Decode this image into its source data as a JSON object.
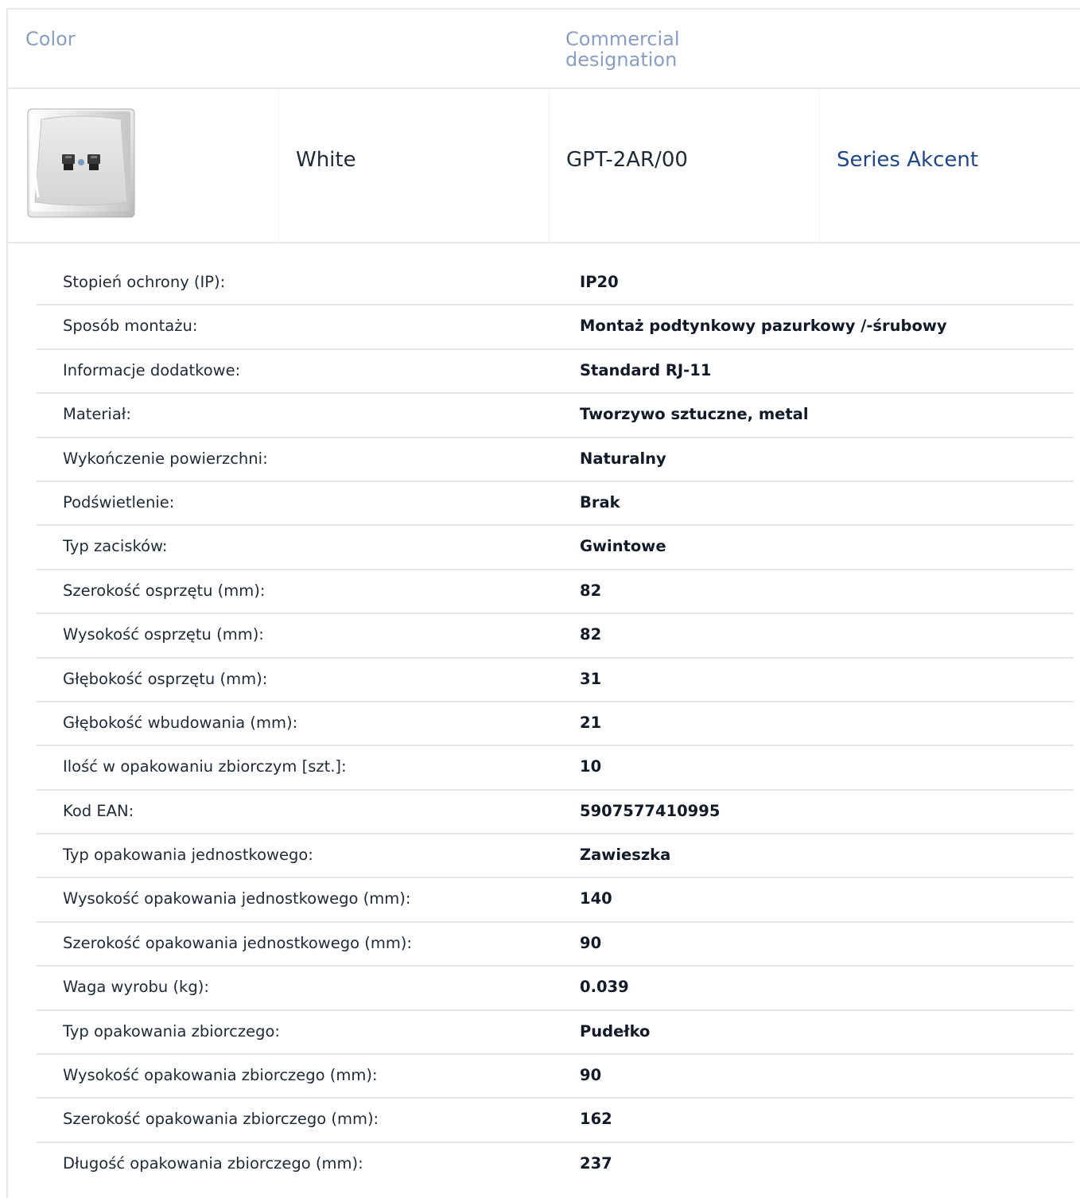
{
  "header": {
    "color_label": "Color",
    "designation_label": "Commercial designation"
  },
  "product": {
    "color": "White",
    "code": "GPT-2AR/00",
    "series": "Series Akcent",
    "thumbnail_icon": "double-telephone-socket-icon"
  },
  "specs": [
    {
      "label": "Stopień ochrony (IP):",
      "value": "IP20"
    },
    {
      "label": "Sposób montażu:",
      "value": "Montaż podtynkowy pazurkowy /-śrubowy"
    },
    {
      "label": "Informacje dodatkowe:",
      "value": "Standard RJ-11"
    },
    {
      "label": "Materiał:",
      "value": "Tworzywo sztuczne, metal"
    },
    {
      "label": "Wykończenie powierzchni:",
      "value": "Naturalny"
    },
    {
      "label": "Podświetlenie:",
      "value": "Brak"
    },
    {
      "label": "Typ zacisków:",
      "value": "Gwintowe"
    },
    {
      "label": "Szerokość osprzętu (mm):",
      "value": "82"
    },
    {
      "label": "Wysokość osprzętu (mm):",
      "value": "82"
    },
    {
      "label": "Głębokość osprzętu (mm):",
      "value": "31"
    },
    {
      "label": "Głębokość wbudowania (mm):",
      "value": "21"
    },
    {
      "label": "Ilość w opakowaniu zbiorczym [szt.]:",
      "value": "10"
    },
    {
      "label": "Kod EAN:",
      "value": "5907577410995"
    },
    {
      "label": "Typ opakowania jednostkowego:",
      "value": "Zawieszka"
    },
    {
      "label": "Wysokość opakowania jednostkowego (mm):",
      "value": "140"
    },
    {
      "label": "Szerokość opakowania jednostkowego (mm):",
      "value": "90"
    },
    {
      "label": "Waga wyrobu (kg):",
      "value": "0.039"
    },
    {
      "label": "Typ opakowania zbiorczego:",
      "value": "Pudełko"
    },
    {
      "label": "Wysokość opakowania zbiorczego (mm):",
      "value": "90"
    },
    {
      "label": "Szerokość opakowania zbiorczego (mm):",
      "value": "162"
    },
    {
      "label": "Długość opakowania zbiorczego (mm):",
      "value": "237"
    }
  ],
  "colors": {
    "header_text": "#8b9ec2",
    "link": "#1f4788",
    "text": "#1e2a38",
    "divider": "#e8e8e8"
  }
}
